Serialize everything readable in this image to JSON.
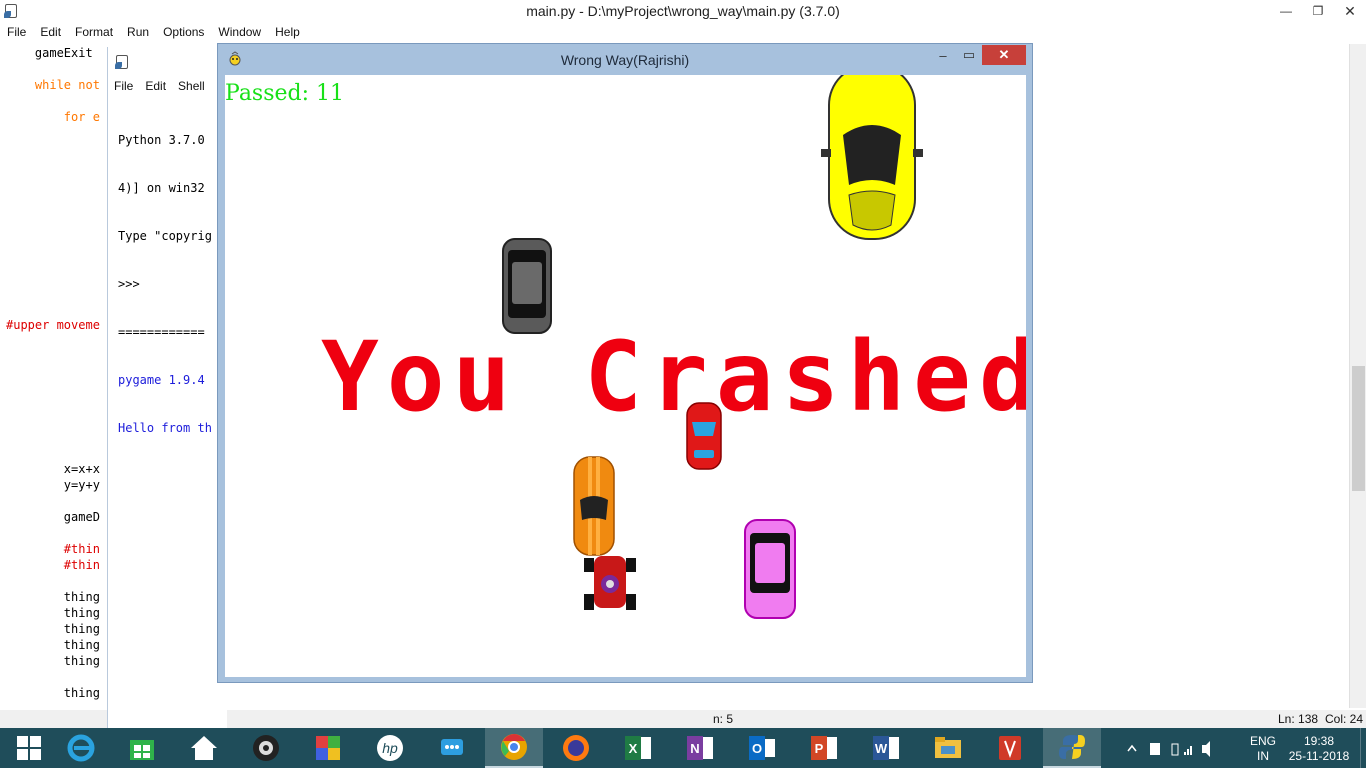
{
  "editor": {
    "title": "main.py - D:\\myProject\\wrong_way\\main.py (3.7.0)",
    "menu": [
      "File",
      "Edit",
      "Format",
      "Run",
      "Options",
      "Window",
      "Help"
    ],
    "code_lines": [
      {
        "text": "    gameExit",
        "cls": ""
      },
      {
        "text": "    while not",
        "cls": "kw"
      },
      {
        "text": "        for e",
        "cls": "kw"
      },
      {
        "text": "#upper moveme",
        "cls": "cm"
      },
      {
        "text": "        x=x+x",
        "cls": ""
      },
      {
        "text": "        y=y+y",
        "cls": ""
      },
      {
        "text": "        gameD",
        "cls": ""
      },
      {
        "text": "        #thin",
        "cls": "cm"
      },
      {
        "text": "        #thin",
        "cls": "cm"
      },
      {
        "text": "        thing",
        "cls": ""
      },
      {
        "text": "        thing",
        "cls": ""
      },
      {
        "text": "        thing",
        "cls": ""
      },
      {
        "text": "        thing",
        "cls": ""
      },
      {
        "text": "        thing",
        "cls": ""
      },
      {
        "text": "        thing",
        "cls": ""
      }
    ],
    "status_line": "Ln: 138",
    "status_col": "Col: 24",
    "status_partial": "n: 5"
  },
  "shell": {
    "menu": [
      "File",
      "Edit",
      "Shell"
    ],
    "lines": [
      {
        "text": "Python 3.7.0",
        "blue": false
      },
      {
        "text": "4)] on win32",
        "blue": false
      },
      {
        "text": "Type \"copyrig",
        "blue": false
      },
      {
        "text": ">>> ",
        "blue": false
      },
      {
        "text": "============",
        "blue": false
      },
      {
        "text": "pygame 1.9.4",
        "blue": true
      },
      {
        "text": "Hello from th",
        "blue": true
      }
    ]
  },
  "game": {
    "title": "Wrong Way(Rajrishi)",
    "score_text": "Passed: 11",
    "crash_text": "You Crashed",
    "controls": {
      "minimize": "–",
      "maximize": "▭",
      "close": "✕"
    },
    "cars": [
      {
        "name": "yellow-car-icon",
        "color": "#ffff00"
      },
      {
        "name": "gray-car-icon",
        "color": "#5a5a5a"
      },
      {
        "name": "red-car-icon",
        "color": "#e01818"
      },
      {
        "name": "orange-car-icon",
        "color": "#f08a10"
      },
      {
        "name": "pink-car-icon",
        "color": "#f07cf0"
      },
      {
        "name": "player-gokart-icon",
        "color": "#c81818"
      }
    ]
  },
  "taskbar": {
    "apps": [
      {
        "name": "start-button-icon",
        "color": "#ffffff"
      },
      {
        "name": "internet-explorer-icon",
        "color": "#2aa3e0"
      },
      {
        "name": "store-icon",
        "color": "#2fb34a"
      },
      {
        "name": "home-icon",
        "color": "#ffffff"
      },
      {
        "name": "webcam-icon",
        "color": "#222222"
      },
      {
        "name": "paint-icon",
        "color": "#e04040"
      },
      {
        "name": "hp-icon",
        "color": "#ffffff"
      },
      {
        "name": "support-assistant-icon",
        "color": "#2d9ee0"
      },
      {
        "name": "chrome-icon",
        "color": "#e8a400"
      },
      {
        "name": "firefox-icon",
        "color": "#ff7a10"
      },
      {
        "name": "excel-icon",
        "color": "#1f7b44"
      },
      {
        "name": "onenote-icon",
        "color": "#7a3da0"
      },
      {
        "name": "outlook-icon",
        "color": "#0a6bc5"
      },
      {
        "name": "powerpoint-icon",
        "color": "#d24726"
      },
      {
        "name": "word-icon",
        "color": "#2b5797"
      },
      {
        "name": "file-explorer-icon",
        "color": "#f0c040"
      },
      {
        "name": "reader-icon",
        "color": "#d03a28"
      },
      {
        "name": "python-icon",
        "color": "#3a6ea5"
      }
    ],
    "lang": "ENG",
    "region": "IN",
    "time": "19:38",
    "date": "25-11-2018"
  }
}
